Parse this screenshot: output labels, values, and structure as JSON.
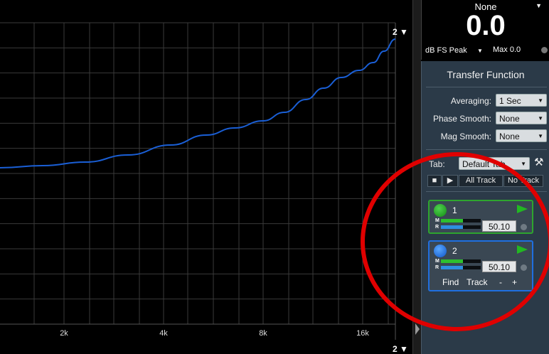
{
  "plot": {
    "x_ticks": [
      "2k",
      "4k",
      "8k",
      "16k"
    ],
    "top_axis_selector": "2 ▼",
    "bottom_axis_selector": "2 ▼",
    "curve_color": "#1a5fd6",
    "grid_color": "#3a3a3a"
  },
  "meter": {
    "source": "None",
    "source_arrow": "▼",
    "value": "0.0",
    "unit": "dB FS Peak",
    "unit_arrow": "▼",
    "max": "Max 0.0"
  },
  "panel": {
    "title": "Transfer Function",
    "settings": [
      {
        "label": "Averaging:",
        "value": "1 Sec"
      },
      {
        "label": "Phase Smooth:",
        "value": "None"
      },
      {
        "label": "Mag Smooth:",
        "value": "None"
      }
    ],
    "tab_label": "Tab:",
    "tab_value": "Default Tab",
    "tool_icon": "wrench-hammer-icon",
    "transport": {
      "stop": "■",
      "play": "▶",
      "all_track": "All Track",
      "no_track": "No Track"
    },
    "tracks": [
      {
        "number": "1",
        "color": "#2ea52e",
        "value": "50.10",
        "m_level": 0.55,
        "r_level": 0.55
      },
      {
        "number": "2",
        "color": "#1f6fe0",
        "value": "50.10",
        "m_level": 0.55,
        "r_level": 0.55
      }
    ],
    "meter_labels": {
      "m": "M",
      "r": "R"
    },
    "track_actions": {
      "find": "Find",
      "track": "Track",
      "minus": "-",
      "plus": "+"
    }
  },
  "annotation": {
    "color": "#e00000"
  }
}
